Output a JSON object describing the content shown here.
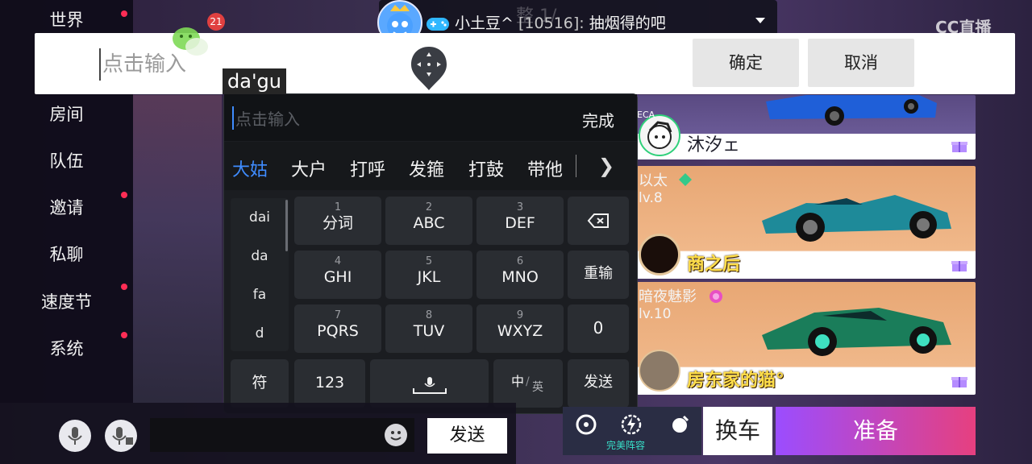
{
  "nav": {
    "items": [
      {
        "label": "世界",
        "dot": true
      },
      {
        "label": "房间",
        "dot": false
      },
      {
        "label": "队伍",
        "dot": false
      },
      {
        "label": "邀请",
        "dot": true
      },
      {
        "label": "私聊",
        "dot": false
      },
      {
        "label": "速度节",
        "dot": true
      },
      {
        "label": "系统",
        "dot": true
      }
    ]
  },
  "chat_banner": {
    "name": "小土豆^",
    "id": "[10516]:",
    "message": "抽烟得的吧",
    "hidden_title": "整 1/"
  },
  "watermark": "CC直播",
  "wechat_badge": "21",
  "input_bar": {
    "placeholder": "点击输入",
    "confirm_label": "确定",
    "cancel_label": "取消"
  },
  "keyboard": {
    "composing": "da'gu",
    "input_placeholder": "点击输入",
    "done_label": "完成",
    "candidates": [
      "大姑",
      "大户",
      "打呼",
      "发箍",
      "打鼓",
      "带他"
    ],
    "more_icon": "chevron-right-icon",
    "pinyin_options": [
      "dai",
      "da",
      "fa",
      "d"
    ],
    "keys": [
      {
        "num": "1",
        "label": "分词"
      },
      {
        "num": "2",
        "label": "ABC"
      },
      {
        "num": "3",
        "label": "DEF"
      },
      {
        "num": "4",
        "label": "GHI"
      },
      {
        "num": "5",
        "label": "JKL"
      },
      {
        "num": "6",
        "label": "MNO"
      },
      {
        "num": "7",
        "label": "PQRS"
      },
      {
        "num": "8",
        "label": "TUV"
      },
      {
        "num": "9",
        "label": "WXYZ"
      }
    ],
    "reinput_label": "重输",
    "zero_label": "0",
    "symbol_label": "符",
    "num_mode_label": "123",
    "lang_switch": {
      "main": "中",
      "alt": "英"
    },
    "send_label": "发送",
    "accent_color": "#3f8cff"
  },
  "players": [
    {
      "nick": "",
      "level": "",
      "name": "沐汐ェ",
      "name_style": "plain",
      "tag": "ECA"
    },
    {
      "nick": "以太",
      "level": "lv.8",
      "name": "商之后",
      "name_style": "gold"
    },
    {
      "nick": "暗夜魅影",
      "level": "lv.10",
      "name": "房东家的猫°",
      "name_style": "gold"
    }
  ],
  "bottom_bar": {
    "send_label": "发送",
    "lineup_label": "完美阵容",
    "change_car_label": "换车",
    "ready_label": "准备"
  },
  "colors": {
    "ready_gradient_start": "#9b4dff",
    "ready_gradient_end": "#e6407f",
    "gold_name": "#ffde4a"
  }
}
